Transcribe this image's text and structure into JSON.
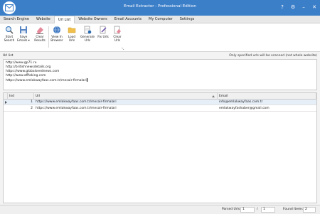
{
  "window": {
    "title": "Email Extractor - Professional Edition",
    "controls": [
      "?",
      "⚙",
      "–",
      "✕"
    ]
  },
  "tabs": [
    {
      "label": "Search Engine",
      "active": false
    },
    {
      "label": "Website",
      "active": false
    },
    {
      "label": "Url List",
      "active": true
    },
    {
      "label": "Website Owners",
      "active": false
    },
    {
      "label": "Email Accounts",
      "active": false
    },
    {
      "label": "My Computer",
      "active": false
    },
    {
      "label": "Settings",
      "active": false
    }
  ],
  "ribbon": {
    "start": {
      "line1": "Start",
      "line2": "Search"
    },
    "save": {
      "line1": "Save",
      "line2": "Emails ▾"
    },
    "clear": {
      "line1": "Clear",
      "line2": "Results"
    },
    "view": {
      "line1": "View In",
      "line2": "Browser"
    },
    "load": {
      "line1": "Load",
      "line2": "Urls"
    },
    "generate": {
      "line1": "Generate",
      "line2": "Urls"
    },
    "fix": {
      "line1": "Fix Urls",
      "line2": ""
    },
    "clearurls": {
      "line1": "Clear",
      "line2": "Urls"
    }
  },
  "url_section": {
    "label": "Url list",
    "note": "Only specified urls will be scanned (not whole website)",
    "urls": [
      "http://www.gp71.ru",
      "http://britishnewsdetails.org",
      "https://www.globalseednews.com",
      "http://www.aflfaking.com",
      "https://www.emlakwayfaas.com.tr/mesair-firmalari"
    ]
  },
  "grid": {
    "columns": {
      "num": "Ind",
      "url": "Url",
      "email": "Email"
    },
    "rows": [
      {
        "num": "1",
        "url": "https://www.emlakwayfaas.com.tr/mesair-firmalari",
        "email": "info@emlakwayfaas.com.tr"
      },
      {
        "num": "2",
        "url": "https://www.emlakwayfaas.com.tr/mesair-firmalari",
        "email": "emlakwayfashaber@gmail.com"
      }
    ]
  },
  "status": {
    "parsed_label": "Parsed Urls:",
    "parsed_value": "1",
    "of_value": "1",
    "found_label": "Found Items:",
    "found_value": "2"
  },
  "colors": {
    "titlebar": "#3c7fc9",
    "accent": "#2b6cb0"
  }
}
